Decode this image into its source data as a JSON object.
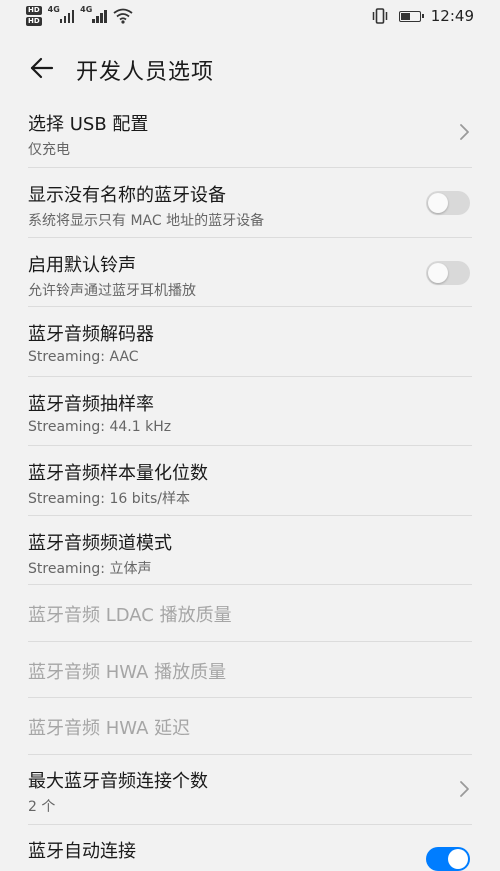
{
  "status_bar": {
    "sim1_badge": "HD",
    "sim2_badge": "HD",
    "sim1_net": "4G",
    "sim2_net": "4G",
    "time": "12:49",
    "battery_level": 0.5,
    "icons": [
      "signal-icon",
      "wifi-icon",
      "vibrate-icon",
      "battery-icon"
    ]
  },
  "header": {
    "title": "开发人员选项",
    "back_icon": "back-arrow-icon"
  },
  "settings": [
    {
      "title": "选择 USB 配置",
      "subtitle": "仅充电",
      "control": "chevron"
    },
    {
      "title": "显示没有名称的蓝牙设备",
      "subtitle": "系统将显示只有 MAC 地址的蓝牙设备",
      "control": "switch",
      "on": false
    },
    {
      "title": "启用默认铃声",
      "subtitle": "允许铃声通过蓝牙耳机播放",
      "control": "switch",
      "on": false
    },
    {
      "title": "蓝牙音频解码器",
      "subtitle": "Streaming: AAC",
      "control": "none"
    },
    {
      "title": "蓝牙音频抽样率",
      "subtitle": "Streaming: 44.1 kHz",
      "control": "none"
    },
    {
      "title": "蓝牙音频样本量化位数",
      "subtitle": "Streaming: 16 bits/样本",
      "control": "none"
    },
    {
      "title": "蓝牙音频频道模式",
      "subtitle": "Streaming: 立体声",
      "control": "none"
    },
    {
      "title": "蓝牙音频 LDAC 播放质量",
      "subtitle": "",
      "control": "none",
      "disabled": true
    },
    {
      "title": "蓝牙音频 HWA 播放质量",
      "subtitle": "",
      "control": "none",
      "disabled": true
    },
    {
      "title": "蓝牙音频 HWA 延迟",
      "subtitle": "",
      "control": "none",
      "disabled": true
    },
    {
      "title": "最大蓝牙音频连接个数",
      "subtitle": "2 个",
      "control": "chevron"
    },
    {
      "title": "蓝牙自动连接",
      "subtitle": "",
      "control": "switch",
      "on": true
    }
  ],
  "colors": {
    "background": "#f2f2f2",
    "accent": "#007dff",
    "disabled_text": "#a6a6a6"
  }
}
